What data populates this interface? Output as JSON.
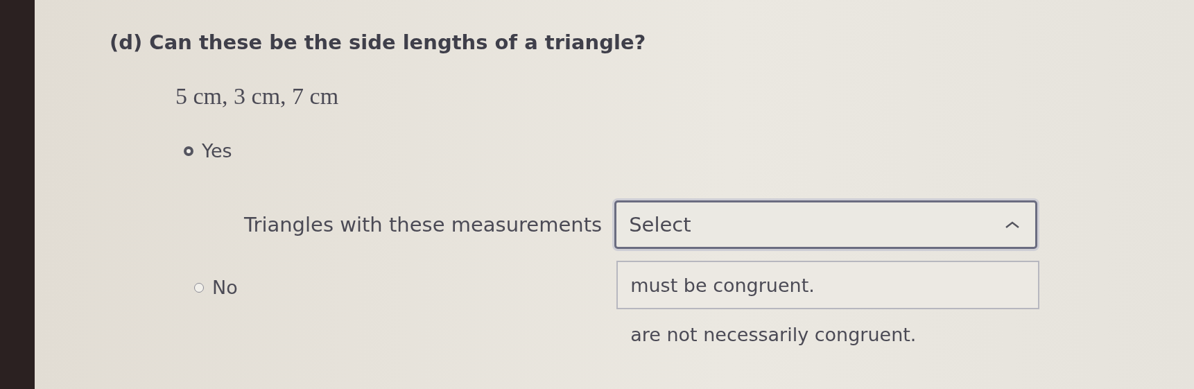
{
  "question": "(d) Can these be the side lengths of a triangle?",
  "lengths": "5 cm, 3 cm, 7 cm",
  "choices": [
    {
      "label": "Yes",
      "selected": true
    },
    {
      "label": "No",
      "selected": false
    }
  ],
  "follow_up": {
    "text": "Triangles with these measurements",
    "select": {
      "value": "Select",
      "expanded": true,
      "options": [
        {
          "label": "must be congruent.",
          "highlighted": true
        },
        {
          "label": "are not necessarily congruent.",
          "highlighted": false
        }
      ]
    }
  }
}
